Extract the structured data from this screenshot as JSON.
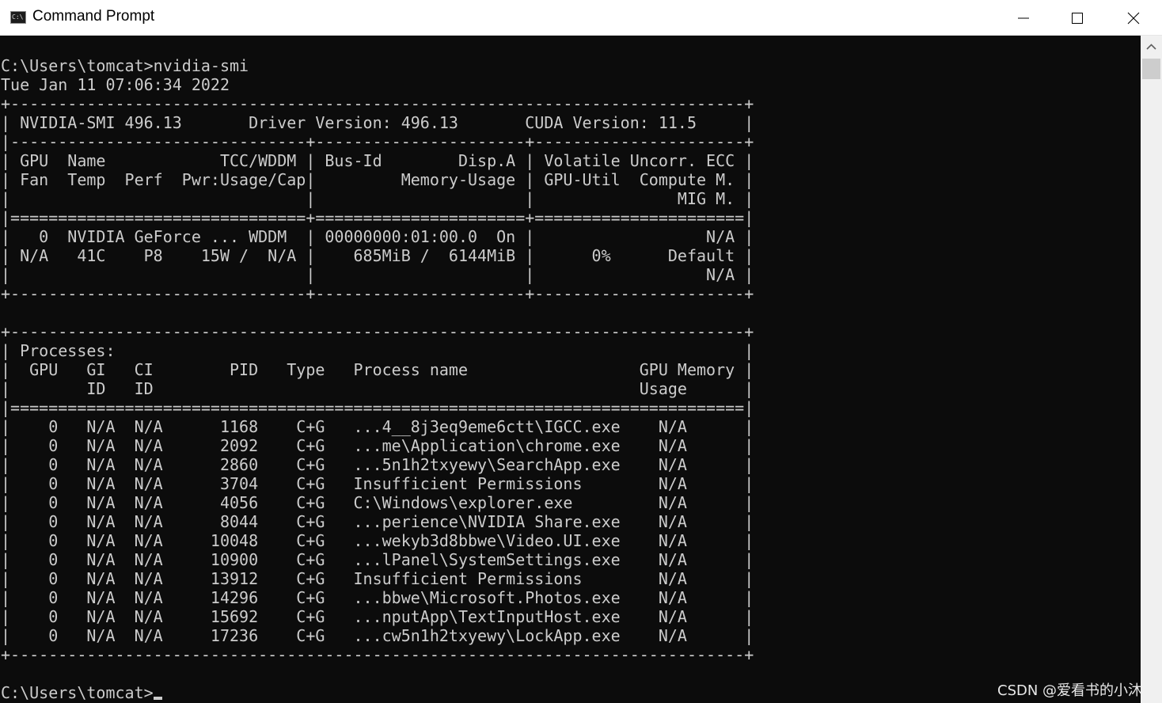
{
  "window": {
    "title": "Command Prompt",
    "icon": "cmd-icon",
    "icon_glyph": "C:\\",
    "controls": {
      "minimize_icon": "minimize-icon",
      "maximize_icon": "maximize-icon",
      "close_icon": "close-icon"
    }
  },
  "console": {
    "lines": [
      "C:\\Users\\tomcat>nvidia-smi",
      "Tue Jan 11 07:06:34 2022",
      "+-----------------------------------------------------------------------------+",
      "| NVIDIA-SMI 496.13       Driver Version: 496.13       CUDA Version: 11.5     |",
      "|-------------------------------+----------------------+----------------------+",
      "| GPU  Name            TCC/WDDM | Bus-Id        Disp.A | Volatile Uncorr. ECC |",
      "| Fan  Temp  Perf  Pwr:Usage/Cap|         Memory-Usage | GPU-Util  Compute M. |",
      "|                               |                      |               MIG M. |",
      "|===============================+======================+======================|",
      "|   0  NVIDIA GeForce ... WDDM  | 00000000:01:00.0  On |                  N/A |",
      "| N/A   41C    P8    15W /  N/A |    685MiB /  6144MiB |      0%      Default |",
      "|                               |                      |                  N/A |",
      "+-------------------------------+----------------------+----------------------+",
      "",
      "+-----------------------------------------------------------------------------+",
      "| Processes:                                                                  |",
      "|  GPU   GI   CI        PID   Type   Process name                  GPU Memory |",
      "|        ID   ID                                                   Usage      |",
      "|=============================================================================|",
      "|    0   N/A  N/A      1168    C+G   ...4__8j3eq9eme6ctt\\IGCC.exe    N/A      |",
      "|    0   N/A  N/A      2092    C+G   ...me\\Application\\chrome.exe    N/A      |",
      "|    0   N/A  N/A      2860    C+G   ...5n1h2txyewy\\SearchApp.exe    N/A      |",
      "|    0   N/A  N/A      3704    C+G   Insufficient Permissions        N/A      |",
      "|    0   N/A  N/A      4056    C+G   C:\\Windows\\explorer.exe         N/A      |",
      "|    0   N/A  N/A      8044    C+G   ...perience\\NVIDIA Share.exe    N/A      |",
      "|    0   N/A  N/A     10048    C+G   ...wekyb3d8bbwe\\Video.UI.exe    N/A      |",
      "|    0   N/A  N/A     10900    C+G   ...lPanel\\SystemSettings.exe    N/A      |",
      "|    0   N/A  N/A     13912    C+G   Insufficient Permissions        N/A      |",
      "|    0   N/A  N/A     14296    C+G   ...bbwe\\Microsoft.Photos.exe    N/A      |",
      "|    0   N/A  N/A     15692    C+G   ...nputApp\\TextInputHost.exe    N/A      |",
      "|    0   N/A  N/A     17236    C+G   ...cw5n1h2txyewy\\LockApp.exe    N/A      |",
      "+-----------------------------------------------------------------------------+",
      ""
    ],
    "prompt": "C:\\Users\\tomcat>"
  },
  "watermark": "CSDN @爱看书的小沐",
  "scrollbar": {
    "up_icon": "scroll-up-arrow-icon"
  }
}
